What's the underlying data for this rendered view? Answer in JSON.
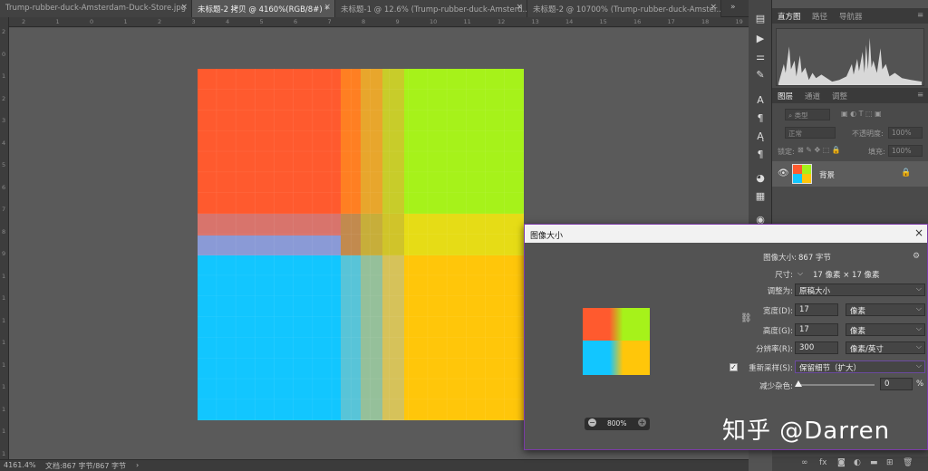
{
  "tabs": [
    {
      "label": "Trump-rubber-duck-Amsterdam-Duck-Store.jpg",
      "close": "×",
      "active": false
    },
    {
      "label": "未标题-2 拷贝 @ 4160%(RGB/8#) *",
      "close": "×",
      "active": true
    },
    {
      "label": "未标题-1 @ 12.6% (Trump-rubber-duck-Amsterd...",
      "close": "×",
      "active": false
    },
    {
      "label": "未标题-2 @ 10700% (Trump-rubber-duck-Amster...",
      "close": "×",
      "active": false
    }
  ],
  "ruler_top_ticks": [
    "2",
    "1",
    "0",
    "1",
    "2",
    "3",
    "4",
    "5",
    "6",
    "7",
    "8",
    "9",
    "10",
    "11",
    "12",
    "13",
    "14",
    "15",
    "16",
    "17",
    "18",
    "19"
  ],
  "ruler_left_ticks": [
    "2",
    "0",
    "1",
    "2",
    "3",
    "4",
    "5",
    "6",
    "7",
    "8",
    "9",
    "1",
    "1",
    "1",
    "1",
    "1",
    "1",
    "1",
    "1",
    "1"
  ],
  "status": {
    "zoom": "4161.4%",
    "doc": "文档:867 字节/867 字节",
    "arrow": "›"
  },
  "histogram_panel": {
    "tabs": [
      "直方图",
      "路径",
      "导航器"
    ]
  },
  "layers_panel": {
    "tabs": [
      "图层",
      "通道",
      "调整"
    ],
    "filter_placeholder": "类型",
    "blend_mode": "正常",
    "opacity_label": "不透明度:",
    "opacity_value": "100%",
    "lock_label": "锁定:",
    "fill_label": "填充:",
    "fill_value": "100%",
    "layer_name": "背景",
    "footer_icons": [
      "link-icon",
      "fx-icon",
      "mask-icon",
      "adjustment-icon",
      "folder-icon",
      "new-layer-icon",
      "trash-icon"
    ]
  },
  "dialog": {
    "title": "图像大小",
    "close": "×",
    "image_size_label": "图像大小:",
    "image_size_value": "867 字节",
    "dimensions_label": "尺寸:",
    "dimensions_value": "17 像素  ×  17 像素",
    "fit_label": "调整为:",
    "fit_value": "原稿大小",
    "width_label": "宽度(D):",
    "width_value": "17",
    "width_unit": "像素",
    "height_label": "高度(G):",
    "height_value": "17",
    "height_unit": "像素",
    "resolution_label": "分辨率(R):",
    "resolution_value": "300",
    "resolution_unit": "像素/英寸",
    "resample_label": "重新采样(S):",
    "resample_checked": true,
    "resample_value": "保留细节（扩大）",
    "noise_label": "减少杂色:",
    "noise_value": "0",
    "noise_unit": "%",
    "zoom_value": "800%",
    "zoom_minus": "−",
    "zoom_plus": "+"
  },
  "watermark": "知乎 @Darren",
  "colors": {
    "dialog_border": "#7c3aa8",
    "tl": "#ff5a2e",
    "tr": "#a6f21a",
    "bl": "#12c6ff",
    "br": "#ffc60a"
  }
}
